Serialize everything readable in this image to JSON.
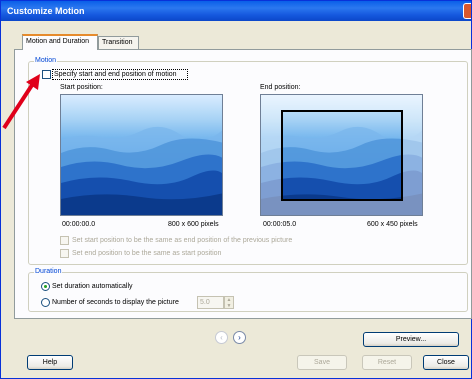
{
  "window": {
    "title": "Customize Motion"
  },
  "tabs": [
    {
      "label": "Motion and Duration",
      "active": true
    },
    {
      "label": "Transition",
      "active": false
    }
  ],
  "motion": {
    "legend": "Motion",
    "specify_checkbox": {
      "label": "Specify start and end position of motion",
      "checked": false
    },
    "start": {
      "label": "Start position:",
      "time": "00:00:00.0",
      "size": "800 x 600 pixels"
    },
    "end": {
      "label": "End position:",
      "time": "00:00:05.0",
      "size": "600 x 450 pixels"
    },
    "option_same_as_previous": {
      "label": "Set start position to be the same as end position of the previous picture",
      "checked": false,
      "enabled": false
    },
    "option_same_as_start": {
      "label": "Set end position to be the same as start position",
      "checked": false,
      "enabled": false
    }
  },
  "duration": {
    "legend": "Duration",
    "auto_radio": {
      "label": "Set duration automatically",
      "selected": true
    },
    "seconds_radio": {
      "label": "Number of seconds to display the picture",
      "selected": false
    },
    "seconds_value": "5.0"
  },
  "nav": {
    "prev_icon": "chevron-left-icon",
    "next_icon": "chevron-right-icon",
    "prev_glyph": "‹",
    "next_glyph": "›"
  },
  "buttons": {
    "preview": "Preview...",
    "help": "Help",
    "save": "Save",
    "reset": "Reset",
    "close": "Close"
  },
  "colors": {
    "titlebar": "#0a5fe8",
    "arrow": "#e0001a",
    "legend_text": "#0046d5"
  }
}
